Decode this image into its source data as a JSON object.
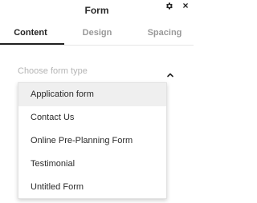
{
  "header": {
    "title": "Form",
    "settings_icon": "gear-icon",
    "close_icon": "close-icon",
    "close_glyph": "×"
  },
  "tabs": [
    {
      "label": "Content",
      "active": true
    },
    {
      "label": "Design",
      "active": false
    },
    {
      "label": "Spacing",
      "active": false
    }
  ],
  "form_type_select": {
    "placeholder": "Choose form type",
    "icon": "chevron-up-icon",
    "expanded": true
  },
  "dropdown": {
    "options": [
      {
        "label": "Application form",
        "highlighted": true
      },
      {
        "label": "Contact Us",
        "highlighted": false
      },
      {
        "label": "Online Pre-Planning Form",
        "highlighted": false
      },
      {
        "label": "Testimonial",
        "highlighted": false
      },
      {
        "label": "Untitled Form",
        "highlighted": false
      }
    ]
  },
  "colors": {
    "text": "#222222",
    "muted": "#999999",
    "placeholder": "#b5b5b5",
    "highlight": "#efefef",
    "border": "#e2e2e2"
  }
}
